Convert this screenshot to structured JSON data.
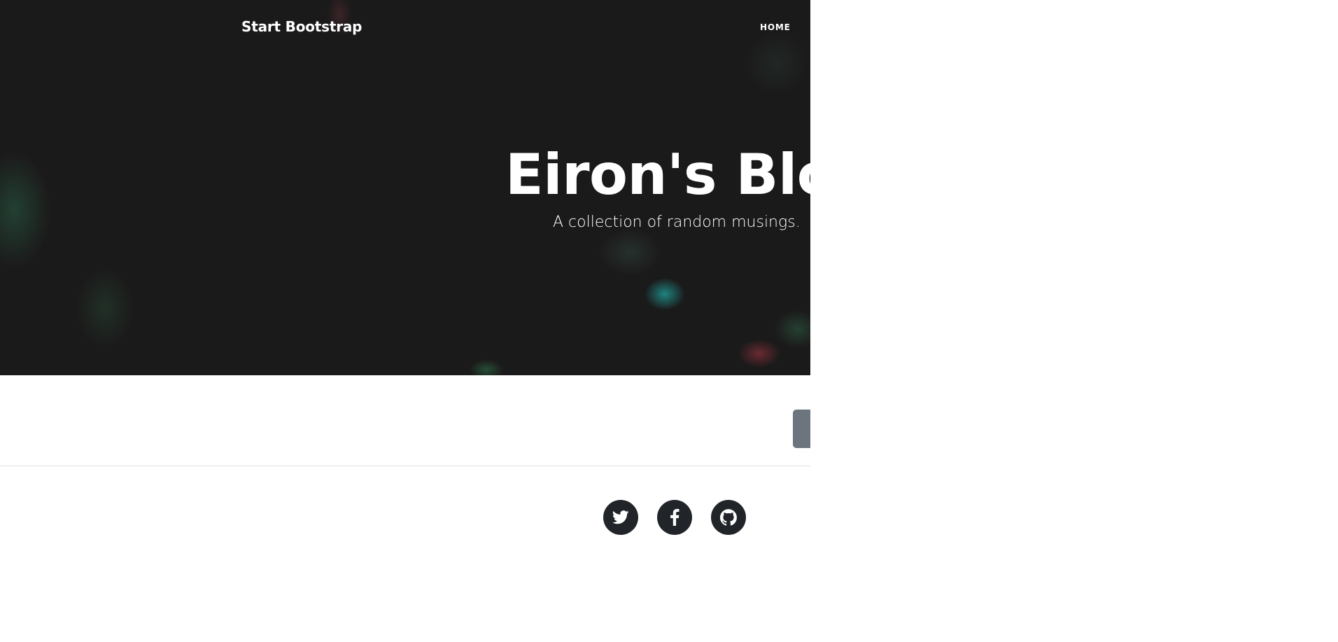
{
  "navbar": {
    "brand": "Start Bootstrap",
    "links": [
      {
        "label": "HOME"
      }
    ]
  },
  "masthead": {
    "title": "Eiron's Blog",
    "subtitle": "A collection of random musings."
  },
  "pager": {
    "older_posts_label": ""
  },
  "footer": {
    "social_icons": [
      "twitter-icon",
      "facebook-icon",
      "github-icon"
    ]
  },
  "colors": {
    "masthead_background": "#1b1a1a",
    "button_secondary": "#6c757d",
    "social_circle": "#212529",
    "text_on_dark": "#ffffff",
    "divider": "#dee2e6"
  }
}
